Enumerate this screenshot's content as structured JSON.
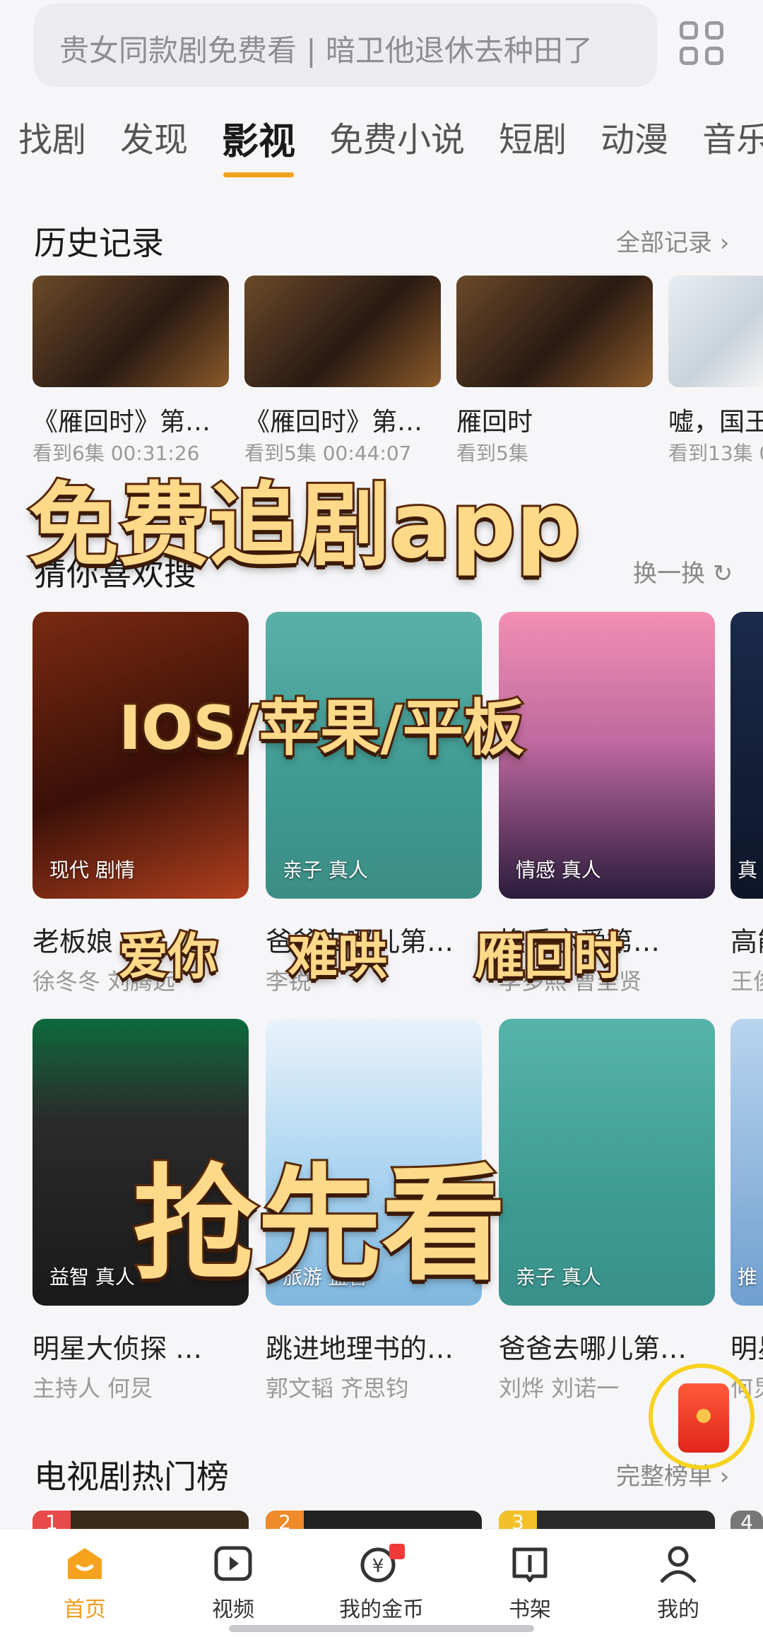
{
  "search": {
    "placeholder": "贵女同款剧免费看 | 暗卫他退休去种田了"
  },
  "tabs": [
    "找剧",
    "发现",
    "影视",
    "免费小说",
    "短剧",
    "动漫",
    "音乐"
  ],
  "history": {
    "title": "历史记录",
    "more": "全部记录",
    "items": [
      {
        "title": "《雁回时》第…",
        "progress": "看到6集 00:31:26"
      },
      {
        "title": "《雁回时》第…",
        "progress": "看到5集 00:44:07"
      },
      {
        "title": "雁回时",
        "progress": "看到5集"
      },
      {
        "title": "嘘，国王",
        "progress": "看到13集 0"
      }
    ]
  },
  "guess": {
    "title": "猜你喜欢搜",
    "more": "换一换",
    "row1": [
      {
        "tag": "现代 剧情",
        "title": "老板娘",
        "people": "徐冬冬 刘腾远"
      },
      {
        "tag": "亲子 真人",
        "title": "爸爸去哪儿第…",
        "people": "李锐"
      },
      {
        "tag": "情感 真人",
        "title": "换乘恋爱第…",
        "people": "李多熙 曹圭贤"
      },
      {
        "tag": "真",
        "title": "高能",
        "people": "王俊"
      }
    ],
    "row2": [
      {
        "tag": "益智 真人",
        "title": "明星大侦探 …",
        "people": "主持人 何炅"
      },
      {
        "tag": "旅游 益智",
        "title": "跳进地理书的…",
        "people": "郭文韬 齐思钧"
      },
      {
        "tag": "亲子 真人",
        "title": "爸爸去哪儿第…",
        "people": "刘烨 刘诺一"
      },
      {
        "tag": "推",
        "title": "明星",
        "people": "何炅"
      }
    ]
  },
  "tvrank": {
    "title": "电视剧热门榜",
    "more": "完整榜单",
    "ranks": [
      "1",
      "2",
      "3",
      "4"
    ]
  },
  "overlay": {
    "line1": "免费追剧app",
    "line2": "IOS/苹果/平板",
    "line3a": "爱你",
    "line3b": "难哄",
    "line3c": "雁回时",
    "line4": "抢先看"
  },
  "nav": [
    "首页",
    "视频",
    "我的金币",
    "书架",
    "我的"
  ],
  "colors": {
    "accent": "#f29b1c",
    "tab_underline": "#f2a21a"
  }
}
